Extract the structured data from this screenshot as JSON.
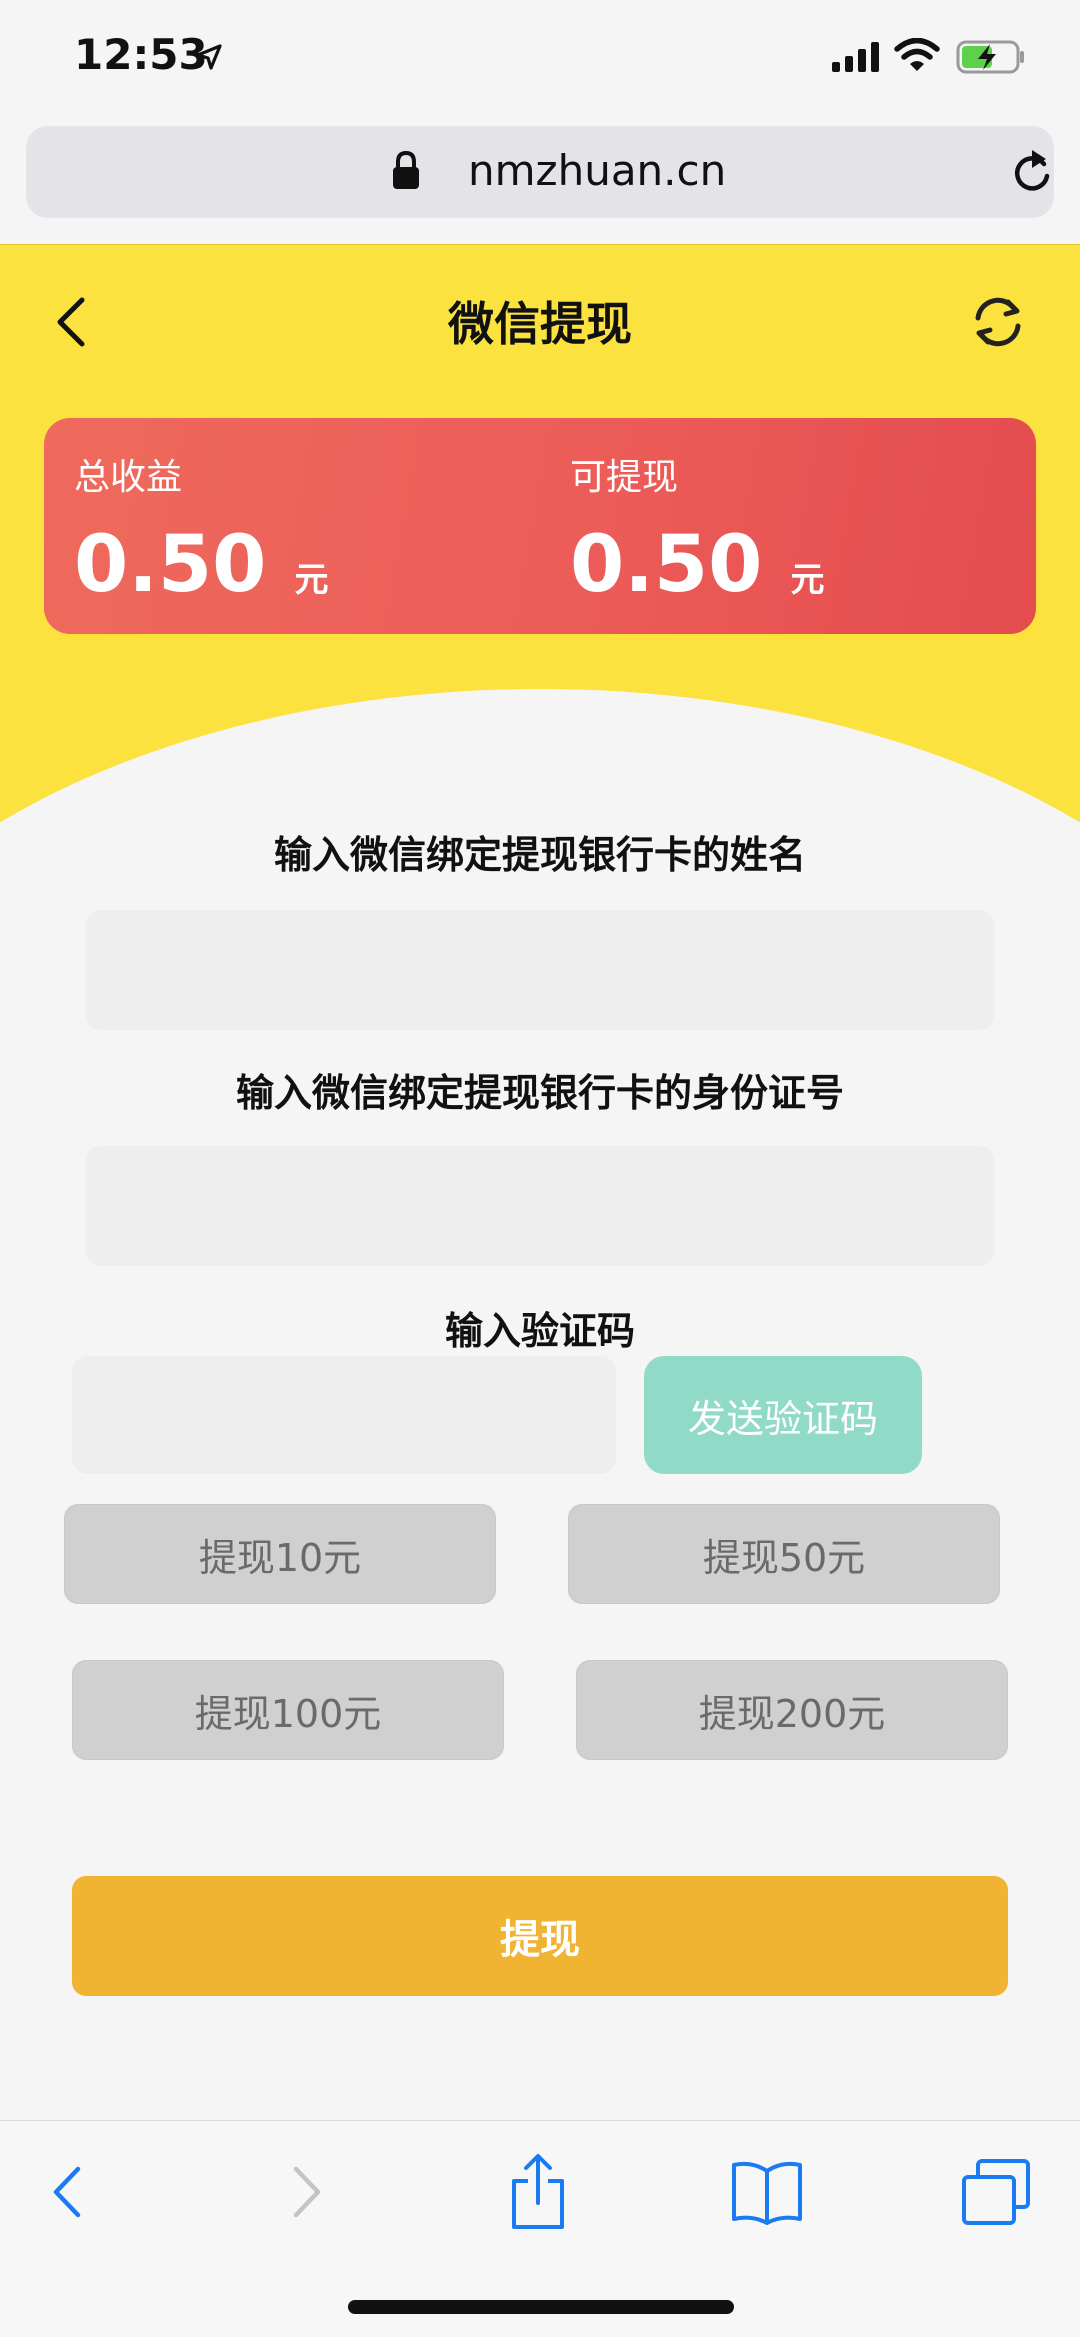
{
  "status_bar": {
    "time": "12:53"
  },
  "browser": {
    "url": "nmzhuan.cn"
  },
  "header": {
    "title": "微信提现"
  },
  "earnings": {
    "total_label": "总收益",
    "total_value": "0.50",
    "total_unit": "元",
    "withdrawable_label": "可提现",
    "withdrawable_value": "0.50",
    "withdrawable_unit": "元"
  },
  "form": {
    "name_label": "输入微信绑定提现银行卡的姓名",
    "name_value": "",
    "id_label": "输入微信绑定提现银行卡的身份证号",
    "id_value": "",
    "code_label": "输入验证码",
    "code_value": "",
    "send_code_label": "发送验证码"
  },
  "amounts": [
    {
      "label": "提现10元"
    },
    {
      "label": "提现50元"
    },
    {
      "label": "提现100元"
    },
    {
      "label": "提现200元"
    }
  ],
  "submit_label": "提现",
  "colors": {
    "header_yellow": "#fbe23f",
    "card_red": "#ec5c58",
    "send_code_green": "#92dac8",
    "submit_orange": "#f0b432",
    "ios_blue": "#1a7cf0"
  }
}
